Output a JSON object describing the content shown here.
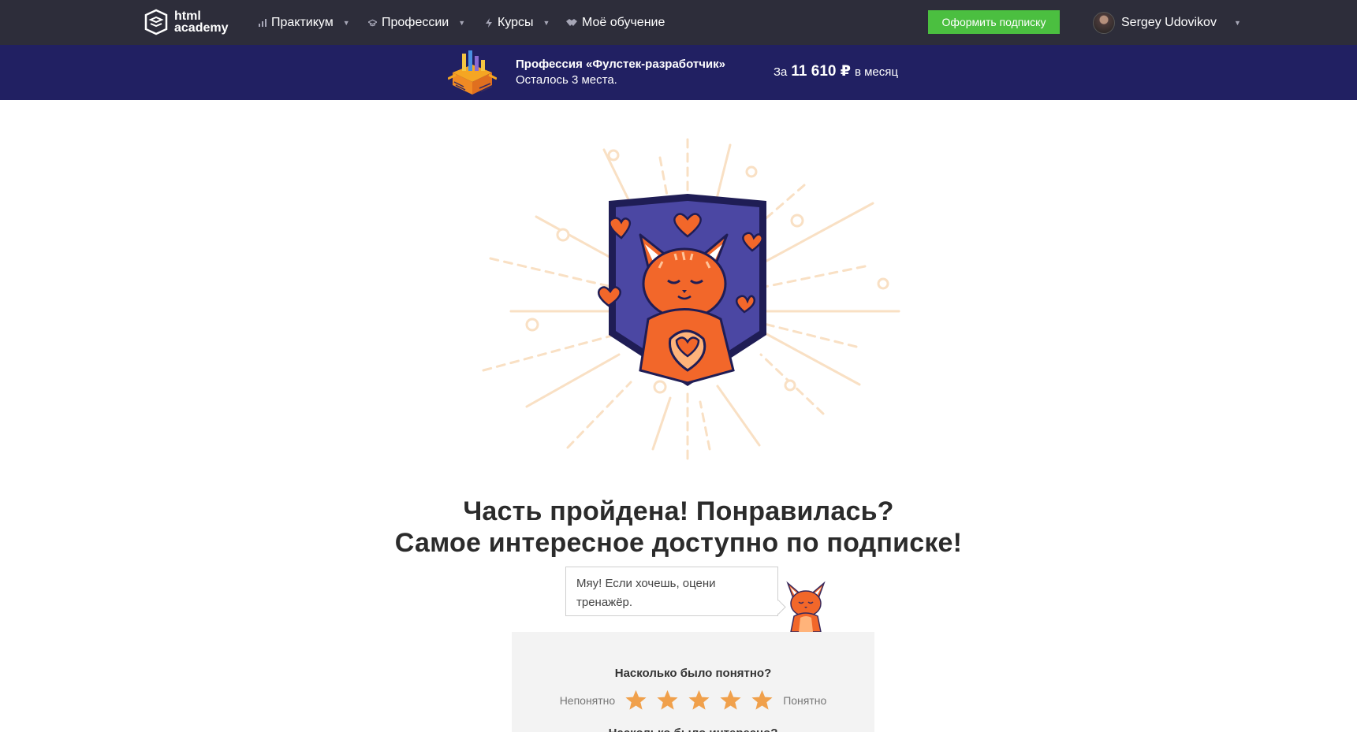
{
  "header": {
    "logo_line1": "html",
    "logo_line2": "academy",
    "nav": [
      {
        "label": "Практикум",
        "icon": "bars-icon"
      },
      {
        "label": "Профессии",
        "icon": "graduation-cap-icon"
      },
      {
        "label": "Курсы",
        "icon": "lightning-icon"
      },
      {
        "label": "Моё обучение",
        "icon": "handshake-icon"
      }
    ],
    "subscribe_label": "Оформить подписку",
    "user_name": "Sergey Udovikov"
  },
  "promo": {
    "title": "Профессия «Фулстек-разработчик»",
    "subtitle": "Осталось 3 места.",
    "price_prefix": "За",
    "price_amount": "11 610 ₽",
    "price_suffix": "в месяц"
  },
  "main": {
    "headline_1": "Часть пройдена! Понравилась?",
    "headline_2": "Самое интересное доступно по подписке!",
    "bubble_text": "Мяу! Если хочешь, оцени тренажёр.",
    "rating": {
      "question": "Насколько было понятно?",
      "low_label": "Непонятно",
      "high_label": "Понятно",
      "stars_count": 5,
      "next_question_partial": "Насколько было интересно?"
    }
  },
  "colors": {
    "nav_bg": "#2d2d3a",
    "promo_bg": "#212062",
    "subscribe_green": "#4bbf40",
    "star_orange": "#f0a04b",
    "badge_purple": "#4b47a3",
    "cat_orange": "#f2672a"
  }
}
